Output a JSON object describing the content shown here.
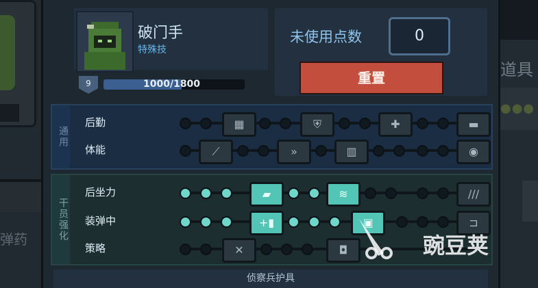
{
  "background": {
    "left_label": "弹药",
    "right_label": "道具"
  },
  "character": {
    "name": "破门手",
    "subtitle": "特殊技",
    "level": "9",
    "xp_text": "1000/1800",
    "xp_current": 1000,
    "xp_max": 1800
  },
  "points": {
    "label": "未使用点数",
    "value": "0",
    "reset_label": "重置"
  },
  "sections": [
    {
      "tab": "通用",
      "rows": [
        {
          "label": "后勤",
          "perks": [
            "ammo-belt-icon",
            "armor-plus-icon",
            "medkit-icon",
            "supply-crate-icon"
          ]
        },
        {
          "label": "体能",
          "perks": [
            "knife-icon",
            "sprint-icon",
            "body-armor-icon",
            "grenade-icon"
          ]
        }
      ]
    },
    {
      "tab": "干员强化",
      "rows": [
        {
          "label": "后坐力",
          "perks": [
            "grip-icon",
            "barrel-icon",
            "stock-icon"
          ]
        },
        {
          "label": "装弹中",
          "perks": [
            "mag-plus-icon",
            "reload-icon",
            "bullet-icon"
          ]
        },
        {
          "label": "策略",
          "perks": [
            "tools-icon",
            "camera-icon"
          ]
        }
      ]
    }
  ],
  "footer": {
    "label": "侦察兵护具"
  },
  "watermark": {
    "text": "豌豆荚"
  },
  "colors": {
    "accent": "#c44e3d",
    "xp": "#3c5f92",
    "active_node": "#6fd6c9"
  }
}
